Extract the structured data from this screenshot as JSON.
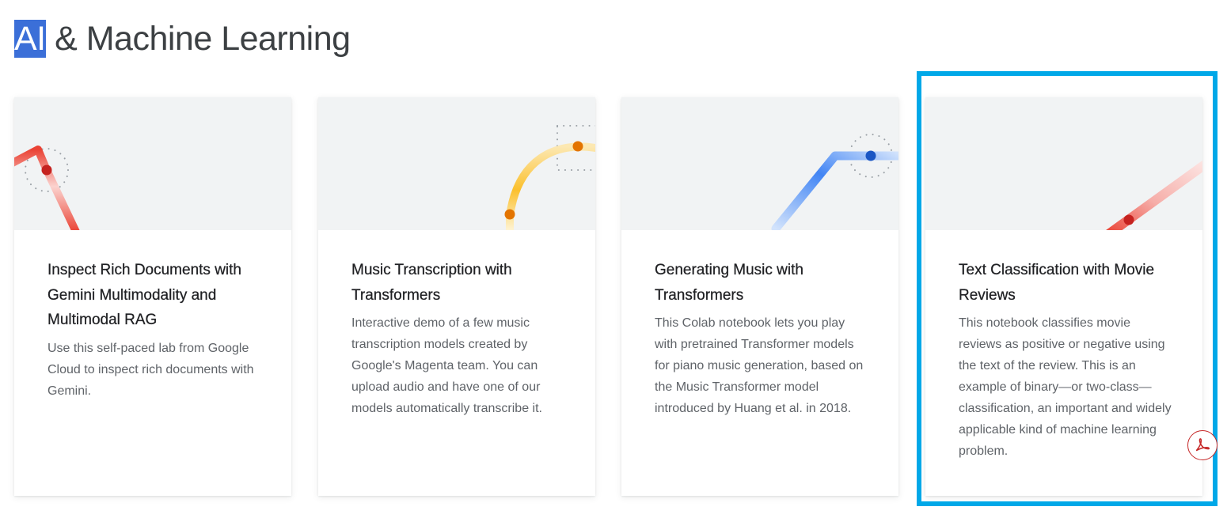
{
  "section": {
    "title_highlight": "AI",
    "title_rest": " & Machine Learning"
  },
  "cards": [
    {
      "title": "Inspect Rich Documents with Gemini Multimodality and Multimodal RAG",
      "description": "Use this self-paced lab from Google Cloud to inspect rich documents with Gemini.",
      "accent_color": "#ea4335",
      "illustration": "red-line-icon"
    },
    {
      "title": "Music Transcription with Transformers",
      "description": "Interactive demo of a few music transcription models created by Google's Magenta team. You can upload audio and have one of our models automatically transcribe it.",
      "accent_color": "#f9ab00",
      "illustration": "yellow-arc-icon"
    },
    {
      "title": "Generating Music with Transformers",
      "description": "This Colab notebook lets you play with pretrained Transformer models for piano music generation, based on the Music Transformer model introduced by Huang et al. in 2018.",
      "accent_color": "#4285f4",
      "illustration": "blue-line-icon"
    },
    {
      "title": "Text Classification with Movie Reviews",
      "description": "This notebook classifies movie reviews as positive or negative using the text of the review. This is an example of binary—or two-class—classification, an important and widely applicable kind of machine learning problem.",
      "accent_color": "#ea4335",
      "illustration": "red-diagonal-icon"
    }
  ],
  "highlight_color": "#00a8e8",
  "pdf_badge": {
    "icon": "pdf-icon",
    "color": "#c62828"
  }
}
